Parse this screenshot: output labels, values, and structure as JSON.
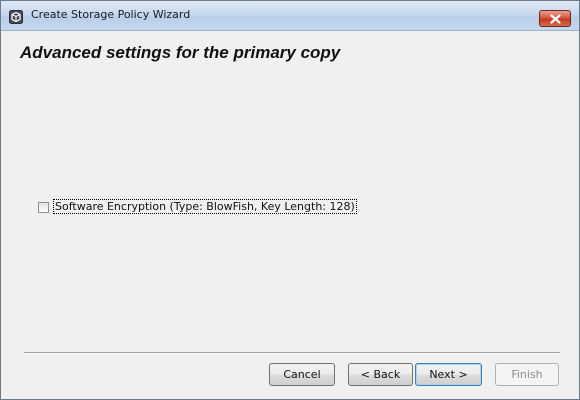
{
  "window": {
    "title": "Create Storage Policy Wizard",
    "icon": "storage-policy-app-icon",
    "close_icon": "close-icon"
  },
  "page": {
    "heading": "Advanced settings for the primary copy"
  },
  "options": {
    "software_encryption": {
      "label": "Software Encryption (Type: BlowFish, Key Length: 128)",
      "checked": false
    }
  },
  "buttons": {
    "cancel": "Cancel",
    "back": "< Back",
    "next": "Next >",
    "finish": "Finish",
    "finish_enabled": false
  },
  "colors": {
    "close_button": "#c23a20",
    "default_button_border": "#3c7fb1",
    "window_background": "#f0f0f0"
  }
}
